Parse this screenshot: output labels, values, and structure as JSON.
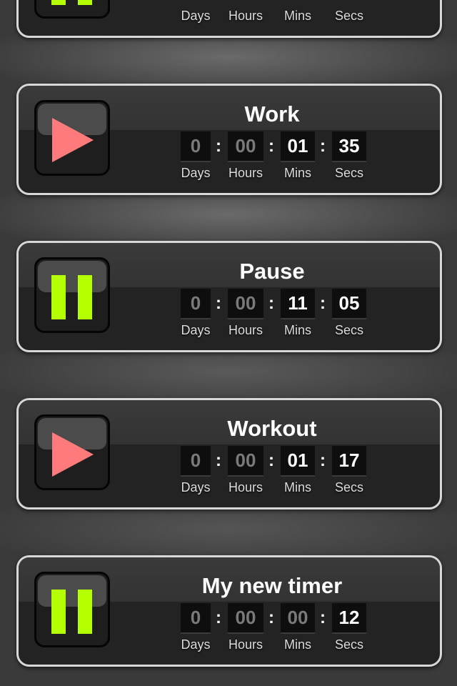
{
  "labels": {
    "days": "Days",
    "hours": "Hours",
    "mins": "Mins",
    "secs": "Secs"
  },
  "colon": ":",
  "colors": {
    "play": "#ff7a7a",
    "pause": "#b4ff00"
  },
  "timers": [
    {
      "state": "paused",
      "icon": "pause-icon"
    },
    {
      "title": "Work",
      "state": "stopped",
      "icon": "play-icon",
      "days": "0",
      "hours": "00",
      "mins": "01",
      "secs": "35"
    },
    {
      "title": "Pause",
      "state": "paused",
      "icon": "pause-icon",
      "days": "0",
      "hours": "00",
      "mins": "11",
      "secs": "05"
    },
    {
      "title": "Workout",
      "state": "stopped",
      "icon": "play-icon",
      "days": "0",
      "hours": "00",
      "mins": "01",
      "secs": "17"
    },
    {
      "title": "My new timer",
      "state": "paused",
      "icon": "pause-icon",
      "days": "0",
      "hours": "00",
      "mins": "00",
      "secs": "12"
    }
  ]
}
